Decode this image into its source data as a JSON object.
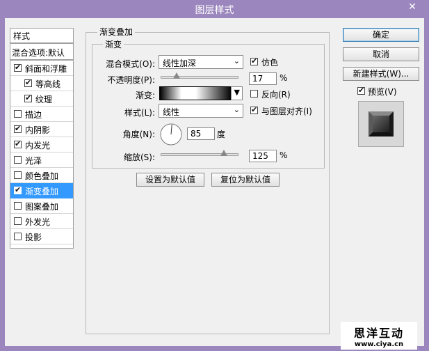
{
  "window": {
    "title": "图层样式",
    "close_symbol": "✕"
  },
  "left_panel": {
    "header": "样式",
    "blend_options": "混合选项:默认",
    "items": [
      {
        "label": "斜面和浮雕",
        "checked": true,
        "indent": false,
        "selected": false
      },
      {
        "label": "等高线",
        "checked": true,
        "indent": true,
        "selected": false
      },
      {
        "label": "纹理",
        "checked": true,
        "indent": true,
        "selected": false
      },
      {
        "label": "描边",
        "checked": false,
        "indent": false,
        "selected": false
      },
      {
        "label": "内阴影",
        "checked": true,
        "indent": false,
        "selected": false
      },
      {
        "label": "内发光",
        "checked": true,
        "indent": false,
        "selected": false
      },
      {
        "label": "光泽",
        "checked": false,
        "indent": false,
        "selected": false
      },
      {
        "label": "颜色叠加",
        "checked": false,
        "indent": false,
        "selected": false
      },
      {
        "label": "渐变叠加",
        "checked": true,
        "indent": false,
        "selected": true
      },
      {
        "label": "图案叠加",
        "checked": false,
        "indent": false,
        "selected": false
      },
      {
        "label": "外发光",
        "checked": false,
        "indent": false,
        "selected": false
      },
      {
        "label": "投影",
        "checked": false,
        "indent": false,
        "selected": false
      }
    ]
  },
  "gradient_overlay": {
    "group_title": "渐变叠加",
    "sub_group_title": "渐变",
    "blend_mode_label": "混合模式(O):",
    "blend_mode_value": "线性加深",
    "dither_label": "仿色",
    "dither_checked": true,
    "opacity_label": "不透明度(P):",
    "opacity_value": "17",
    "opacity_fraction": 0.17,
    "percent": "%",
    "gradient_label": "渐变:",
    "reverse_label": "反向(R)",
    "reverse_checked": false,
    "style_label": "样式(L):",
    "style_value": "线性",
    "align_label": "与图层对齐(I)",
    "align_checked": true,
    "angle_label": "角度(N):",
    "angle_value": "85",
    "angle_unit": "度",
    "scale_label": "缩放(S):",
    "scale_value": "125",
    "scale_fraction": 0.83,
    "set_default": "设置为默认值",
    "reset_default": "复位为默认值"
  },
  "right_panel": {
    "ok": "确定",
    "cancel": "取消",
    "new_style": "新建样式(W)...",
    "preview_label": "预览(V)",
    "preview_checked": true
  },
  "watermark": {
    "line1": "思洋互动",
    "line2": "www.ciya.cn"
  },
  "colors": {
    "titlebar": "#9b86bd",
    "selection": "#3399ff"
  }
}
